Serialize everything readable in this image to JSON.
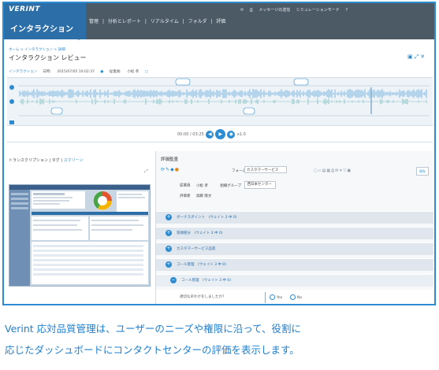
{
  "app": {
    "logo_text": "VERINT",
    "title": "インタラクション"
  },
  "nav": {
    "items": [
      "管理",
      "|",
      "分析とレポート",
      "|",
      "リアルタイム",
      "|",
      "フォルダ",
      "|",
      "評価"
    ]
  },
  "topbar_right": [
    "メッセージの送信",
    "シミュレーションモード",
    "?"
  ],
  "breadcrumb": "ホーム > インタラクション > 詳細",
  "page_title": "インタラクション レビュー",
  "info_row": {
    "tab": "インタラクション",
    "date_label": "日時:",
    "date_value": "2015/07/05 10:02:37",
    "agent_label": "従業員:",
    "agent_value": "小松 孝"
  },
  "player": {
    "time": "00:00 / 03:25",
    "speed": "x1.0"
  },
  "transcript": {
    "tab_label": "トランスクリプション",
    "separator": " | ",
    "tag_label": "タグ",
    "screen_label": "スクリーン"
  },
  "eval": {
    "header": "評価監査",
    "form_label": "フォーム",
    "form_value": "カスタマーサービス",
    "save_label": "保存",
    "employee_label": "従業員",
    "employee_value": "小松 孝",
    "group_label": "組織グループ",
    "group_value": "西日本センター",
    "evaluator_label": "評価者",
    "evaluator_value": "加藤 隆文",
    "sections": [
      "ボーナスポイント　(ウェイト 3 中 0)",
      "冒頭部分　(ウェイト 3 中 0)",
      "カスタマーサービス品質",
      "コール管理　(ウェイト 3 中 0)",
      "コール管理　(ウェイト 3 中 0)"
    ],
    "question": "適切な声かけをしましたか?",
    "yes": "Yes",
    "no": "No"
  },
  "caption": {
    "line1": "Verint 応対品質管理は、ユーザーのニーズや権限に沿って、役割に",
    "line2": "応じたダッシュボードにコンタクトセンターの評価を表示します。"
  },
  "colors": {
    "brand_blue": "#2c6ea8",
    "accent_blue": "#2d8bd0",
    "topbar_gray": "#4c5a66",
    "caption_blue": "#1e7fcf"
  }
}
